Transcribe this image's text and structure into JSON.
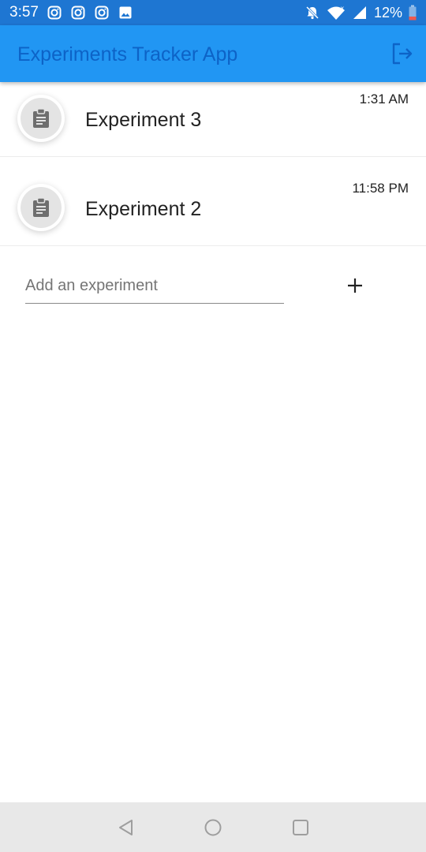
{
  "status_bar": {
    "time": "3:57",
    "battery": "12%",
    "notification_icons": [
      "instagram-icon",
      "instagram-icon",
      "instagram-icon",
      "image-icon"
    ],
    "system_icons": [
      "notifications-off-icon",
      "wifi-icon",
      "cell-signal-icon",
      "battery-icon"
    ],
    "color": "#1e76d2"
  },
  "app_bar": {
    "title": "Experiments Tracker App",
    "action_icon": "logout-icon",
    "color": "#2196f3",
    "title_color": "#0d63c7"
  },
  "experiments": [
    {
      "name": "Experiment 3",
      "time": "1:31 AM",
      "icon": "clipboard-icon"
    },
    {
      "name": "Experiment 2",
      "time": "11:58 PM",
      "icon": "clipboard-icon"
    }
  ],
  "add_form": {
    "placeholder": "Add an experiment",
    "value": "",
    "button_icon": "plus-icon"
  },
  "nav_bar": {
    "buttons": [
      "back-icon",
      "home-icon",
      "recents-icon"
    ]
  }
}
